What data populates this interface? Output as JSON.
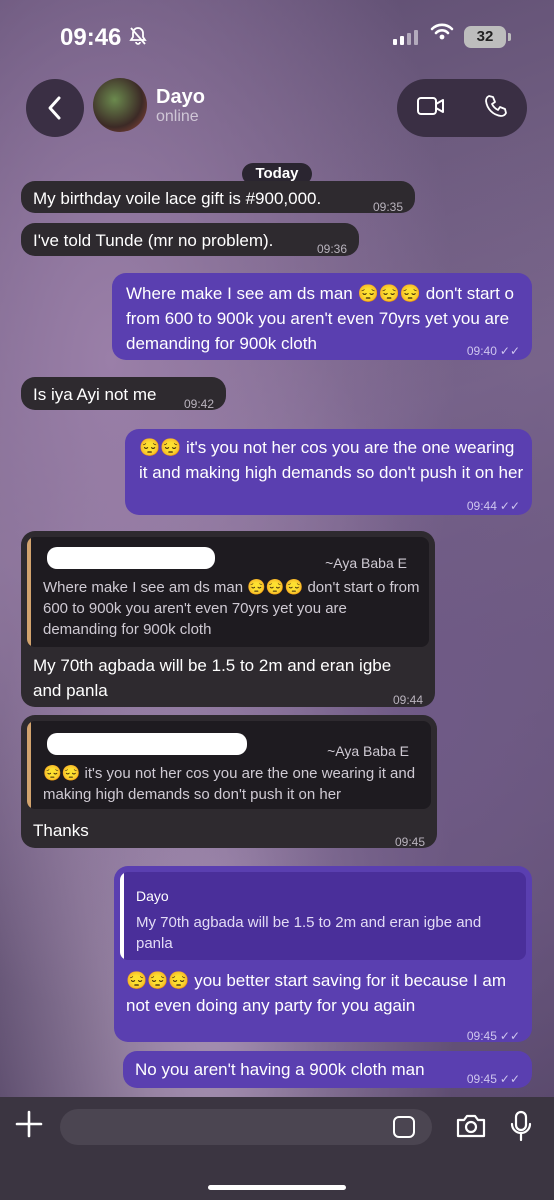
{
  "status_bar": {
    "time": "09:46",
    "battery": "32"
  },
  "header": {
    "name": "Dayo",
    "status": "online"
  },
  "date_separator": "Today",
  "messages": [
    {
      "dir": "in",
      "text": "My birthday voile lace gift is #900,000.",
      "time": "09:35"
    },
    {
      "dir": "in",
      "text": "I've told Tunde (mr no problem).",
      "time": "09:36"
    },
    {
      "dir": "out",
      "text": "Where make I see am ds man 😔😔😔 don't start o from 600 to 900k you aren't even 70yrs yet you are demanding for 900k cloth",
      "time": "09:40"
    },
    {
      "dir": "in",
      "text": "Is iya Ayi not me",
      "time": "09:42"
    },
    {
      "dir": "out",
      "text": "😔😔 it's you not her cos you are the one wearing it and making high demands so don't push it on her",
      "time": "09:44"
    },
    {
      "dir": "in",
      "quote_author": "~Aya Baba E",
      "quote_text": "Where make I see am ds man 😔😔😔 don't start o from 600 to 900k you aren't even 70yrs yet you are demanding for 900k cloth",
      "text": "My 70th agbada will be 1.5   to 2m and eran igbe and panla",
      "time": "09:44"
    },
    {
      "dir": "in",
      "quote_author": "~Aya Baba E",
      "quote_text": "😔😔 it's you not her cos you are the one wearing it and making high demands so don't push it on her",
      "text": "Thanks",
      "time": "09:45"
    },
    {
      "dir": "out",
      "quote_author": "Dayo",
      "quote_text": "My 70th agbada will be 1.5   to 2m and eran igbe and panla",
      "text": "😔😔😔 you better start saving for it because I am not even doing any party for you again",
      "time": "09:45"
    },
    {
      "dir": "out",
      "text": "No you aren't having a 900k cloth man",
      "time": "09:45"
    }
  ],
  "colors": {
    "incoming": "#2e2a2f",
    "outgoing": "#5a3fb0",
    "input_bar": "#3b3541"
  },
  "icons": [
    "back-icon",
    "video-call-icon",
    "phone-icon",
    "plus-icon",
    "sticker-icon",
    "camera-icon",
    "mic-icon",
    "read-ticks-icon"
  ]
}
